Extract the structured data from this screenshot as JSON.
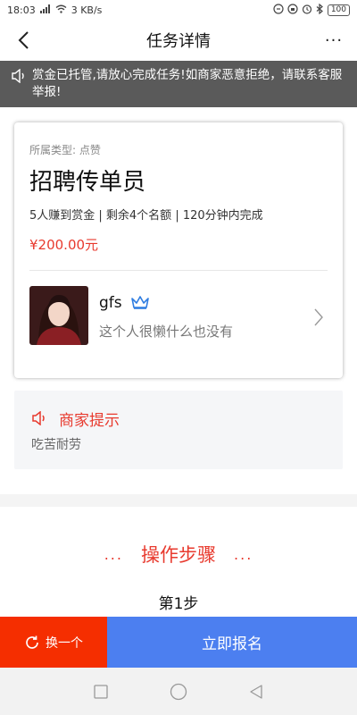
{
  "status_bar": {
    "time": "18:03",
    "network_speed": "3 KB/s",
    "battery": "100"
  },
  "nav": {
    "title": "任务详情",
    "more": "···"
  },
  "notice": {
    "text": "赏金已托管,请放心完成任务!如商家恶意拒绝，请联系客服举报!"
  },
  "task": {
    "type_label": "所属类型: 点赞",
    "title": "招聘传单员",
    "meta": "5人赚到赏金 | 剩余4个名额 | 120分钟内完成",
    "price": "¥200.00元"
  },
  "merchant": {
    "name": "gfs",
    "bio": "这个人很懒什么也没有"
  },
  "merchant_tip": {
    "title": "商家提示",
    "body": "吃苦耐劳"
  },
  "steps": {
    "title": "操作步骤",
    "dots": "...",
    "step_label": "第1步"
  },
  "actions": {
    "switch_label": "换一个",
    "apply_label": "立即报名"
  },
  "colors": {
    "accent_red": "#e83a2e",
    "switch_bg": "#f52e00",
    "apply_bg": "#4c7ff0",
    "notice_bg": "#5a5a5a",
    "crown_blue": "#2f7de1"
  }
}
